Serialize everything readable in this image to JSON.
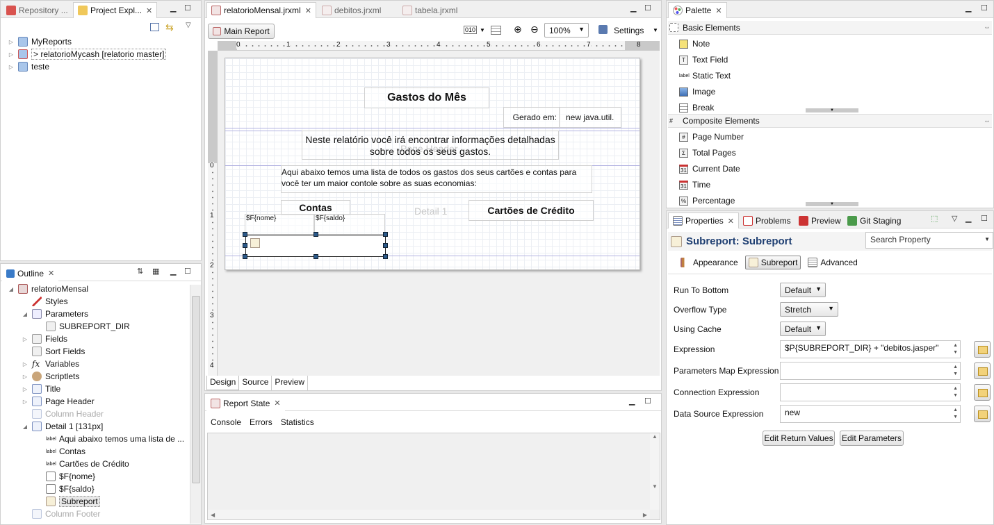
{
  "left_top": {
    "tabs": [
      {
        "label": "Repository ...",
        "active": false
      },
      {
        "label": "Project Expl...",
        "active": true
      }
    ],
    "tree": [
      {
        "label": "MyReports"
      },
      {
        "label": "> relatorioMycash [relatorio master]"
      },
      {
        "label": "teste"
      }
    ]
  },
  "outline": {
    "tab": "Outline",
    "items": [
      {
        "label": "relatorioMensal"
      },
      {
        "label": "Styles"
      },
      {
        "label": "Parameters"
      },
      {
        "label": "SUBREPORT_DIR"
      },
      {
        "label": "Fields"
      },
      {
        "label": "Sort Fields"
      },
      {
        "label": "Variables"
      },
      {
        "label": "Scriptlets"
      },
      {
        "label": "Title"
      },
      {
        "label": "Page Header"
      },
      {
        "label": "Column Header"
      },
      {
        "label": "Detail 1 [131px]"
      },
      {
        "label": "Aqui abaixo temos uma lista de ..."
      },
      {
        "label": "Contas"
      },
      {
        "label": "Cartões de Crédito"
      },
      {
        "label": "$F{nome}"
      },
      {
        "label": "$F{saldo}"
      },
      {
        "label": "Subreport"
      },
      {
        "label": "Column Footer"
      }
    ]
  },
  "editor": {
    "tabs": [
      {
        "label": "relatorioMensal.jrxml",
        "active": true
      },
      {
        "label": "debitos.jrxml",
        "active": false
      },
      {
        "label": "tabela.jrxml",
        "active": false
      }
    ],
    "main_report_btn": "Main Report",
    "zoom": "100%",
    "settings": "Settings",
    "ruler_labels": [
      "0",
      "1",
      "2",
      "3",
      "4",
      "5",
      "6",
      "7",
      "8"
    ],
    "vruler_labels": [
      "0",
      "1",
      "2",
      "3",
      "4"
    ],
    "bottom_tabs": [
      "Design",
      "Source",
      "Preview"
    ]
  },
  "report": {
    "title": "Gastos do Mês",
    "generated_label": "Gerado em:",
    "generated_value": "new java.util.",
    "intro_line1": "Neste relatório você irá encontrar informações detalhadas",
    "intro_line2": "sobre todos os seus gastos.",
    "page_header_watermark": "Page Header",
    "desc_line1": "Aqui abaixo temos uma lista de todos os gastos dos seus cartões e contas para",
    "desc_line2": "você ter um maior contole sobre as suas economias:",
    "contas": "Contas",
    "detail_watermark": "Detail 1",
    "cartoes": "Cartões de Crédito",
    "field_nome": "$F{nome}",
    "field_saldo": "$F{saldo}"
  },
  "report_state": {
    "tab": "Report State",
    "subtabs": [
      "Console",
      "Errors",
      "Statistics"
    ]
  },
  "palette": {
    "tab": "Palette",
    "basic_header": "Basic Elements",
    "basic": [
      {
        "label": "Note",
        "icon": "note-icon"
      },
      {
        "label": "Text Field",
        "icon": "text-field-icon"
      },
      {
        "label": "Static Text",
        "icon": "static-text-icon"
      },
      {
        "label": "Image",
        "icon": "image-icon"
      },
      {
        "label": "Break",
        "icon": "break-icon"
      }
    ],
    "composite_header": "Composite Elements",
    "composite": [
      {
        "label": "Page Number",
        "icon": "page-number-icon"
      },
      {
        "label": "Total Pages",
        "icon": "total-pages-icon"
      },
      {
        "label": "Current Date",
        "icon": "current-date-icon"
      },
      {
        "label": "Time",
        "icon": "time-icon"
      },
      {
        "label": "Percentage",
        "icon": "percentage-icon"
      }
    ]
  },
  "properties": {
    "tabs": [
      "Properties",
      "Problems",
      "Preview",
      "Git Staging"
    ],
    "title": "Subreport: Subreport",
    "search_placeholder": "Search Property",
    "sections": [
      "Appearance",
      "Subreport",
      "Advanced"
    ],
    "run_to_bottom_label": "Run To Bottom",
    "run_to_bottom_value": "Default",
    "overflow_label": "Overflow Type",
    "overflow_value": "Stretch",
    "using_cache_label": "Using Cache",
    "using_cache_value": "Default",
    "expression_label": "Expression",
    "expression_value": "$P{SUBREPORT_DIR} + \"debitos.jasper\"",
    "params_map_label": "Parameters Map Expression",
    "params_map_value": "",
    "connection_label": "Connection Expression",
    "connection_value": "",
    "datasource_label": "Data Source Expression",
    "datasource_value": "new",
    "edit_return_btn": "Edit Return Values",
    "edit_params_btn": "Edit Parameters"
  }
}
